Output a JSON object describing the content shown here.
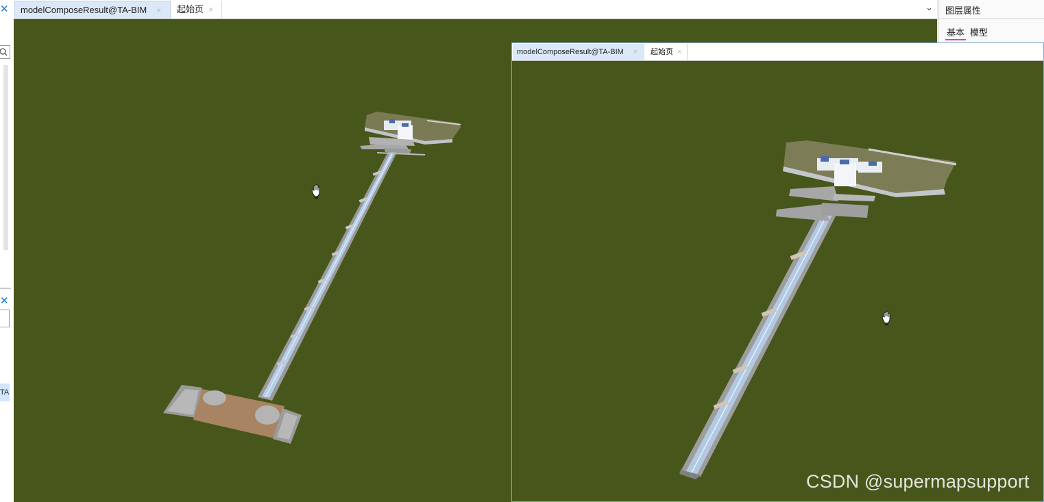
{
  "left_panel": {
    "close_glyph": "✕",
    "truncated_item": "TA"
  },
  "main_tabs": [
    {
      "label": "modelComposeResult@TA-BIM",
      "close": "×",
      "active": true
    },
    {
      "label": "起始页",
      "close": "×",
      "active": false
    }
  ],
  "tab_dropdown_glyph": "⌄",
  "right_panel": {
    "title": "图层属性",
    "tabs": [
      "基本",
      "模型"
    ]
  },
  "floating_window": {
    "tabs": [
      {
        "label": "modelComposeResult@TA-BIM",
        "close": "×",
        "active": true
      },
      {
        "label": "起始页",
        "close": "×",
        "active": false
      }
    ]
  },
  "watermark": "CSDN @supermapsupport",
  "colors": {
    "scene_background": "#47561a",
    "active_tab": "#dbe8f8",
    "accent_underline": "#d44e8a"
  },
  "icons": {
    "cursor": "hand-cursor-icon",
    "close": "close-icon",
    "dropdown": "chevron-down-icon",
    "search": "search-icon"
  }
}
